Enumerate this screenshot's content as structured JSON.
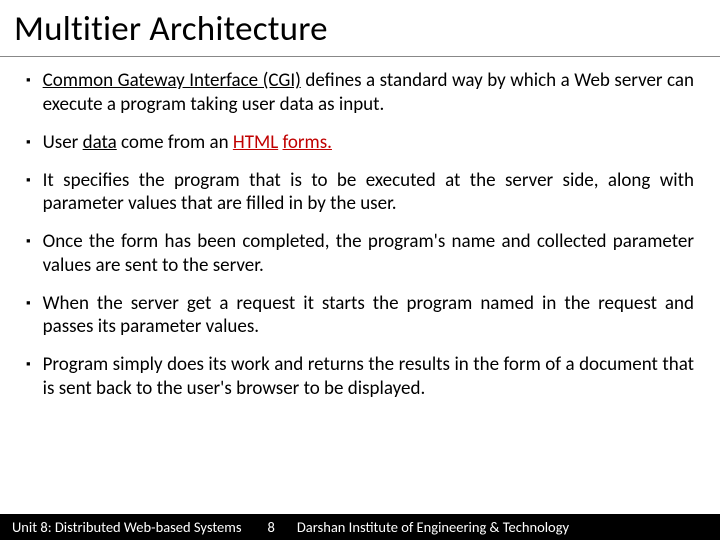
{
  "title": "Multitier Architecture",
  "bullets": {
    "b1_pre": "Common Gateway Interface (CGI)",
    "b1_post": " defines a standard way by which a Web server can execute a program taking user data as input.",
    "b2_a": "User ",
    "b2_b": "data",
    "b2_c": " come from an ",
    "b2_d": "HTML",
    "b2_e": " ",
    "b2_f": "forms.",
    "b3": "It specifies the program that is to be executed at the server side, along with parameter values that are filled in by the user.",
    "b4": "Once the form has been completed, the program's name and collected parameter values are sent to the server.",
    "b5": "When the server get a request it starts the program named in the request and passes its parameter values.",
    "b6": "Program simply does its work and returns the results in the form of a document that is sent back to the user's browser to be displayed."
  },
  "footer": {
    "left": "Unit 8: Distributed Web-based Systems",
    "page": "8",
    "right": "Darshan Institute of Engineering & Technology"
  }
}
